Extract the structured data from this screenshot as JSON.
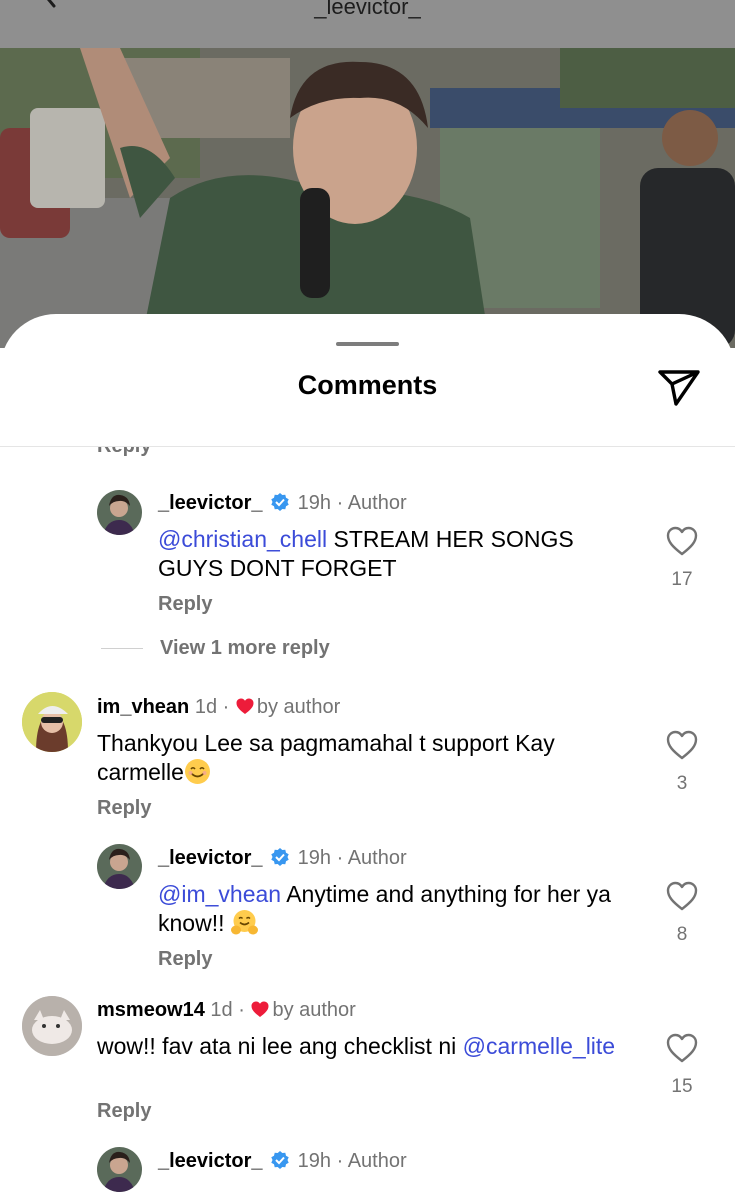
{
  "header": {
    "title": "_leevictor_"
  },
  "sheet": {
    "title": "Comments"
  },
  "comments": {
    "top_reply_label": "Reply",
    "c1": {
      "username": "_leevictor_",
      "time": "19h",
      "sep": "·",
      "tag": "Author",
      "mention": "@christian_chell",
      "text": " STREAM HER SONGS GUYS DONT FORGET",
      "likes": "17",
      "reply": "Reply"
    },
    "view_more": "View 1 more reply",
    "c2": {
      "username": "im_vhean",
      "time": "1d",
      "sep": "·",
      "tag": "by author",
      "text": "Thankyou Lee sa pagmamahal t support Kay carmelle",
      "emoji": "smiling-face-emoji",
      "likes": "3",
      "reply": "Reply"
    },
    "c3": {
      "username": "_leevictor_",
      "time": "19h",
      "sep": "·",
      "tag": "Author",
      "mention": "@im_vhean",
      "text": " Anytime and anything for her ya know!! ",
      "emoji": "hugging-face-emoji",
      "likes": "8",
      "reply": "Reply"
    },
    "c4": {
      "username": "msmeow14",
      "time": "1d",
      "sep": "·",
      "tag": "by author",
      "text": "wow!! fav ata ni lee ang checklist ni ",
      "mention": "@carmelle_lite",
      "likes": "15",
      "reply": "Reply"
    },
    "c5": {
      "username": "_leevictor_",
      "time": "19h",
      "sep": "·",
      "tag": "Author"
    }
  },
  "colors": {
    "mention": "#3b4bd8",
    "verified": "#3897f0",
    "heart": "#ed1c3a",
    "secondary_text": "#737373"
  },
  "icons": {
    "back": "chevron-left-icon",
    "share": "send-icon",
    "like": "heart-outline-icon",
    "verified": "verified-badge-icon"
  }
}
